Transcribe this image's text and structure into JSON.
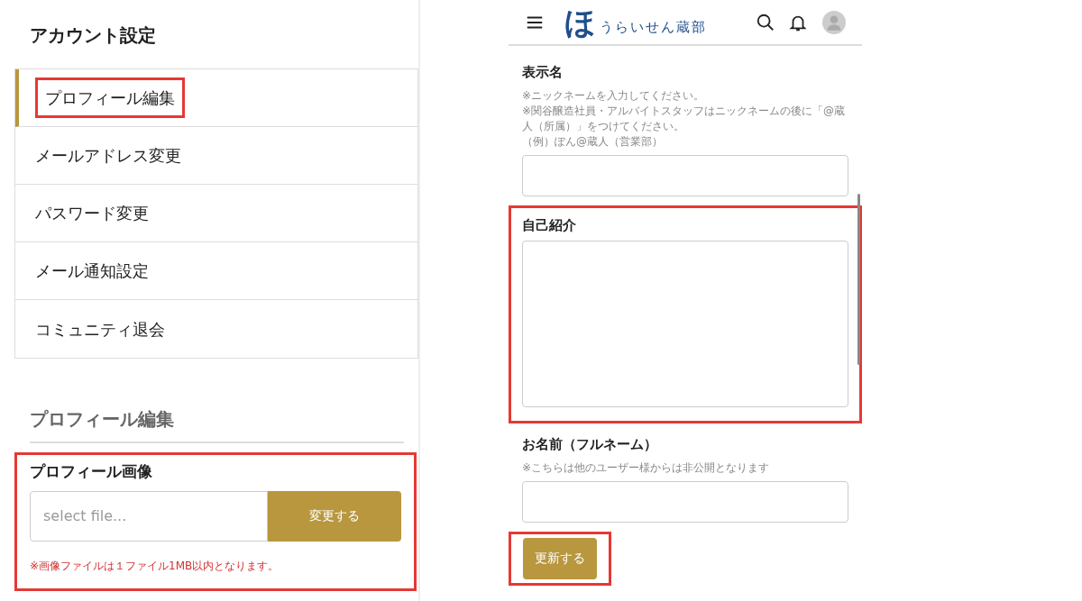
{
  "account_settings": {
    "title": "アカウント設定",
    "menu": [
      {
        "label": "プロフィール編集",
        "selected": true,
        "highlighted": true
      },
      {
        "label": "メールアドレス変更",
        "selected": false,
        "highlighted": false
      },
      {
        "label": "パスワード変更",
        "selected": false,
        "highlighted": false
      },
      {
        "label": "メール通知設定",
        "selected": false,
        "highlighted": false
      },
      {
        "label": "コミュニティ退会",
        "selected": false,
        "highlighted": false
      }
    ],
    "section_title": "プロフィール編集",
    "profile_image": {
      "label": "プロフィール画像",
      "placeholder": "select file...",
      "button": "変更する",
      "note": "※画像ファイルは１ファイル1MB以内となります。",
      "highlighted": true
    }
  },
  "mobile": {
    "header": {
      "logo_mark": "ほ",
      "logo_text": "うらいせん蔵部"
    },
    "fields": [
      {
        "kind": "input",
        "label": "表示名",
        "notes": [
          "※ニックネームを入力してください。",
          "※関谷醸造社員・アルバイトスタッフはニックネームの後に「@蔵人（所属）」をつけてください。",
          "（例）ぽん@蔵人（営業部）"
        ],
        "highlighted": false
      },
      {
        "kind": "textarea",
        "label": "自己紹介",
        "highlighted": true
      },
      {
        "kind": "input",
        "label": "お名前（フルネーム）",
        "notes": [
          "※こちらは他のユーザー様からは非公開となります"
        ],
        "highlighted": false
      }
    ],
    "submit": {
      "label": "更新する",
      "highlighted": true
    }
  }
}
